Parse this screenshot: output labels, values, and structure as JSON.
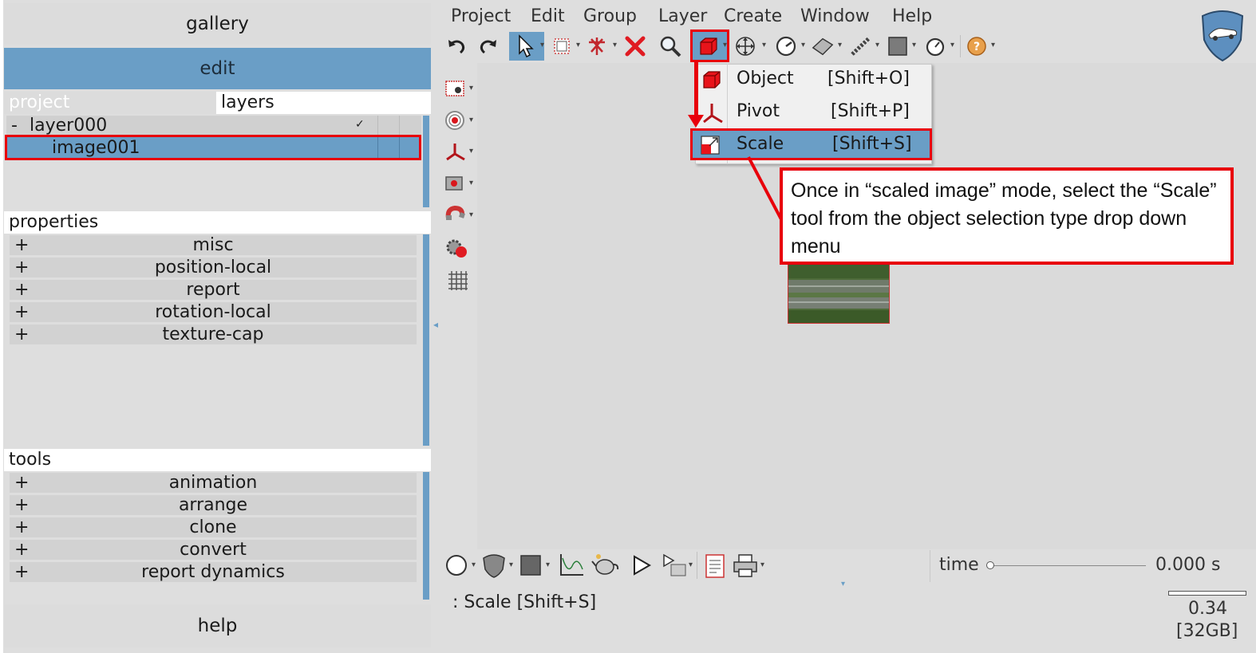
{
  "left_panel": {
    "gallery": "gallery",
    "edit": "edit",
    "tabs": {
      "project": "project",
      "layers": "layers"
    },
    "tree": {
      "layer_toggle": "-",
      "layer_name": "layer000",
      "layer_check": "✓",
      "image_name": "image001"
    },
    "properties": {
      "title": "properties",
      "items": [
        {
          "sign": "+",
          "label": "misc"
        },
        {
          "sign": "+",
          "label": "position-local"
        },
        {
          "sign": "+",
          "label": "report"
        },
        {
          "sign": "+",
          "label": "rotation-local"
        },
        {
          "sign": "+",
          "label": "texture-cap"
        }
      ]
    },
    "tools": {
      "title": "tools",
      "items": [
        {
          "sign": "+",
          "label": "animation"
        },
        {
          "sign": "+",
          "label": "arrange"
        },
        {
          "sign": "+",
          "label": "clone"
        },
        {
          "sign": "+",
          "label": "convert"
        },
        {
          "sign": "+",
          "label": "report dynamics"
        }
      ]
    },
    "help": "help"
  },
  "menu": [
    "Project",
    "Edit",
    "Group",
    "Layer",
    "Create",
    "Window",
    "Help"
  ],
  "dropdown": {
    "items": [
      {
        "label": "Object",
        "shortcut": "[Shift+O]"
      },
      {
        "label": "Pivot",
        "shortcut": "[Shift+P]"
      },
      {
        "label": "Scale",
        "shortcut": "[Shift+S]"
      }
    ]
  },
  "callout": {
    "text": "Once in “scaled image” mode, select the “Scale” tool from the object selection type drop down menu"
  },
  "bottom": {
    "time_label": "time",
    "time_value": "0.000 s",
    "status": ": Scale [Shift+S]",
    "memory_value": "0.34",
    "memory_total": "[32GB]"
  },
  "colors": {
    "accent": "#6a9ec6",
    "annotation": "#e8000b",
    "panel": "#dedede"
  }
}
